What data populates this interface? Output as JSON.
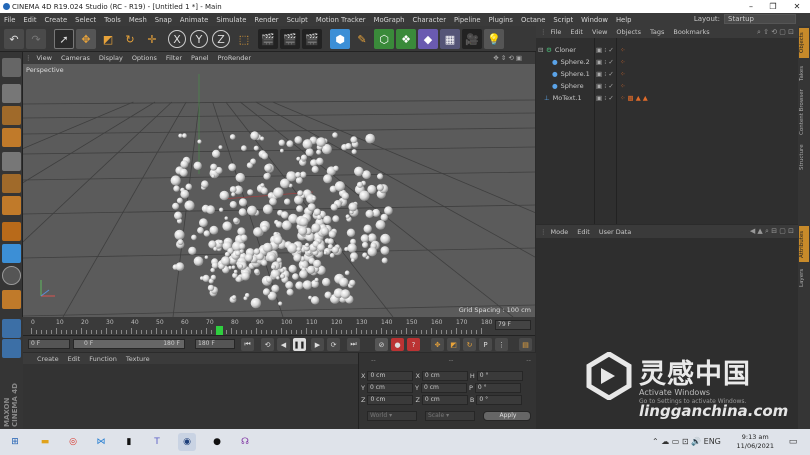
{
  "titlebar": {
    "title": "CINEMA 4D R19.024 Studio (RC - R19) - [Untitled 1 *] - Main",
    "controls": [
      "–",
      "❐",
      "✕"
    ]
  },
  "menubar": {
    "items": [
      "File",
      "Edit",
      "Create",
      "Select",
      "Tools",
      "Mesh",
      "Snap",
      "Animate",
      "Simulate",
      "Render",
      "Sculpt",
      "Motion Tracker",
      "MoGraph",
      "Character",
      "Pipeline",
      "Plugins",
      "Octane",
      "Script",
      "Window",
      "Help"
    ],
    "layout_label": "Layout:",
    "layout_value": "Startup"
  },
  "viewport": {
    "menu": [
      "View",
      "Cameras",
      "Display",
      "Options",
      "Filter",
      "Panel",
      "ProRender"
    ],
    "label": "Perspective",
    "grid_spacing": "Grid Spacing : 100 cm"
  },
  "timeline": {
    "ticks": [
      "0",
      "10",
      "20",
      "30",
      "40",
      "50",
      "60",
      "70",
      "80",
      "90",
      "100",
      "110",
      "120",
      "130",
      "140",
      "150",
      "160",
      "170",
      "180"
    ],
    "current_frame": "79 F",
    "playhead_frame": 75,
    "max_frame": 190
  },
  "transport": {
    "start": "0 F",
    "range_start": "0 F",
    "range_end": "180 F",
    "end": "180 F"
  },
  "material": {
    "menu": [
      "Create",
      "Edit",
      "Function",
      "Texture"
    ]
  },
  "coords": {
    "dashes": [
      "--",
      "--",
      "--"
    ],
    "rows": [
      {
        "a": "X",
        "v1": "0 cm",
        "b": "X",
        "v2": "0 cm",
        "c": "H",
        "v3": "0 °"
      },
      {
        "a": "Y",
        "v1": "0 cm",
        "b": "Y",
        "v2": "0 cm",
        "c": "P",
        "v3": "0 °"
      },
      {
        "a": "Z",
        "v1": "0 cm",
        "b": "Z",
        "v2": "0 cm",
        "c": "B",
        "v3": "0 °"
      }
    ],
    "mode1": "World",
    "mode2": "Scale",
    "apply": "Apply"
  },
  "objects": {
    "menu": [
      "File",
      "Edit",
      "View",
      "Objects",
      "Tags",
      "Bookmarks"
    ],
    "rows": [
      {
        "name": "Cloner",
        "indent": 0
      },
      {
        "name": "Sphere.2",
        "indent": 1
      },
      {
        "name": "Sphere.1",
        "indent": 1
      },
      {
        "name": "Sphere",
        "indent": 1
      },
      {
        "name": "MoText.1",
        "indent": 0
      }
    ]
  },
  "attributes": {
    "menu": [
      "Mode",
      "Edit",
      "User Data"
    ]
  },
  "right_tabs": [
    "Objects",
    "Takes",
    "Content Browser",
    "Structure",
    "Attributes",
    "Layers"
  ],
  "left_logo": "MAXON CINEMA 4D",
  "watermark": {
    "cn": "灵感中国",
    "url": "lingganchina.com",
    "activate": "Activate Windows",
    "activate_sub": "Go to Settings to activate Windows."
  },
  "taskbar": {
    "time": "9:13 am",
    "date": "11/06/2021"
  },
  "colors": {
    "accent": "#3c8fd6",
    "viewport": "#5b5b5b",
    "panel": "#2f2f2f"
  }
}
